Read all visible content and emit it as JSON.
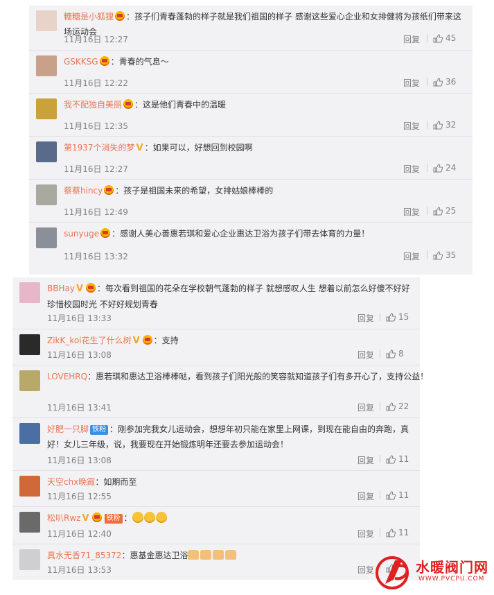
{
  "top_comments": [
    {
      "user": "糖糖是小狐狸",
      "badges": [
        "crown"
      ],
      "text": "孩子们青春蓬勃的样子就是我们祖国的样子 感谢这些爱心企业和女排健将为孩纸们带来这场运动会",
      "time": "11月16日 12:27",
      "reply": "回复",
      "likes": "45",
      "avatar": "#e8d3c8"
    },
    {
      "user": "GSKKSG",
      "badges": [
        "crown"
      ],
      "text": "青春的气息～",
      "time": "11月16日 12:22",
      "reply": "回复",
      "likes": "36",
      "avatar": "#c9a089"
    },
    {
      "user": "我不配独自美丽",
      "badges": [
        "crown"
      ],
      "text": "这是他们青春中的温暖",
      "time": "11月16日 12:35",
      "reply": "回复",
      "likes": "32",
      "avatar": "#c9a23a"
    },
    {
      "user": "第1937个消失的梦",
      "badges": [
        "v"
      ],
      "text": "如果可以，好想回到校园啊",
      "time": "11月16日 12:27",
      "reply": "回复",
      "likes": "24",
      "avatar": "#5a6a8a"
    },
    {
      "user": "蔡蔡hincy",
      "badges": [
        "crown"
      ],
      "text": "孩子是祖国未来的希望，女排姑娘棒棒的",
      "time": "11月16日 12:49",
      "reply": "回复",
      "likes": "25",
      "avatar": "#a9a9a0"
    },
    {
      "user": "sunyuge",
      "badges": [
        "crown"
      ],
      "text": "感谢人美心善惠若琪和爱心企业惠达卫浴为孩子们带去体育的力量！",
      "time": "11月16日 13:32",
      "reply": "回复",
      "likes": "35",
      "avatar": "#8a8f9a"
    }
  ],
  "bottom_comments": [
    {
      "user": "BBHay",
      "badges": [
        "v",
        "crown"
      ],
      "text": "每次看到祖国的花朵在学校朝气蓬勃的样子 就想感叹人生 想着以前怎么好傻不好好珍惜校园时光 不好好规划青春",
      "time": "11月16日 13:33",
      "reply": "回复",
      "likes": "15",
      "avatar": "#e7b6c8"
    },
    {
      "user": "ZikK_koi花生了什么树",
      "badges": [
        "v",
        "crown"
      ],
      "text": "支持",
      "time": "11月16日 13:08",
      "reply": "回复",
      "likes": "8",
      "avatar": "#2a2a2a"
    },
    {
      "user": "LOVEHRQ",
      "badges": [],
      "text": "惠若琪和惠达卫浴棒棒哒，看到孩子们阳光般的笑容就知道孩子们有多开心了，支持公益！",
      "time": "11月16日 13:41",
      "reply": "回复",
      "likes": "22",
      "avatar": "#b8a86a"
    },
    {
      "user": "好肥一只脚",
      "badges": [
        "fan"
      ],
      "fan_label": "铁粉",
      "text": "刚参加完我女儿运动会，想想年初只能在家里上网课，到现在能自由的奔跑，真好！女儿三年级，说，我要现在开始锻炼明年还要去参加运动会！",
      "time": "11月16日 13:08",
      "reply": "回复",
      "likes": "11",
      "avatar": "#4a6fa5"
    },
    {
      "user": "天空chx晚霞",
      "badges": [],
      "text": "如期而至",
      "time": "11月16日 12:55",
      "reply": "回复",
      "likes": "11",
      "avatar": "#d0693a"
    },
    {
      "user": "松叭Rwz",
      "badges": [
        "v",
        "crown",
        "fan-red"
      ],
      "fan_label": "铁粉",
      "text": "",
      "emojis": 3,
      "time": "11月16日 12:40",
      "reply": "回复",
      "likes": "11",
      "avatar": "#6a6a6a"
    },
    {
      "user": "真水无香71_85372",
      "badges": [],
      "text": "惠基金惠达卫浴",
      "thumbs": 4,
      "time": "11月16日 13:53",
      "reply": "回复",
      "likes": "",
      "avatar": "#cfcfcf"
    }
  ],
  "watermark": {
    "title": "水暖阀门网",
    "url": "WWW.PVCPU.COM"
  }
}
